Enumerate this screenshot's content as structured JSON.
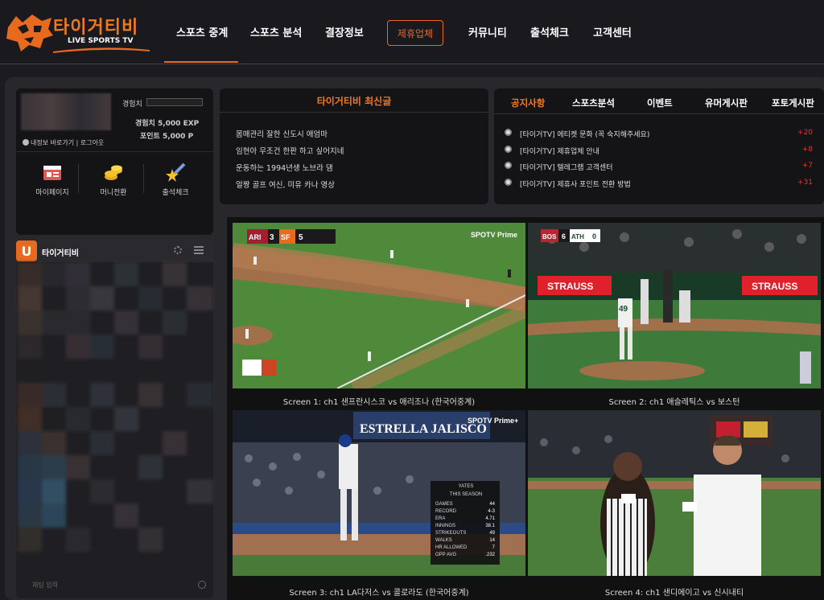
{
  "brand": {
    "name": "타이거티비",
    "tagline": "LIVE SPORTS TV"
  },
  "nav": {
    "items": [
      "스포츠 중계",
      "스포츠 분석",
      "결장정보",
      "제휴업체",
      "커뮤니티",
      "출석체크",
      "고객센터"
    ],
    "active_highlight": "제휴업체",
    "underline_item": "스포츠 중계"
  },
  "user": {
    "exp_label": "경험치",
    "exp_value": "경험치 5,000 EXP",
    "points_value": "포인트 5,000 P",
    "links": "내정보 바로가기 | 로그아웃",
    "quick": [
      "마이페이지",
      "머니전환",
      "출석체크"
    ]
  },
  "chat": {
    "title": "타이거티비",
    "input_placeholder": "채팅 입력"
  },
  "latest": {
    "title": "타이거티비 최신글",
    "posts": [
      "몸매관리 잘한 신도시 애엄마",
      "임현아 무조건 한판 하고 싶어지네",
      "운동하는 1994년생 노브라 댐",
      "얼짱 골프 여신, 미유 카나 영상"
    ]
  },
  "notice": {
    "tabs": [
      "공지사항",
      "스포츠분석",
      "이벤트",
      "유머게시판",
      "포토게시판"
    ],
    "active_tab": "공지사항",
    "items": [
      {
        "text": "[타이거TV] 에티켓 문화 (꼭 숙지해주세요)",
        "count": "+20"
      },
      {
        "text": "[타이거TV] 제휴업체 안내",
        "count": "+8"
      },
      {
        "text": "[타이거TV] 텔레그램 고객센터",
        "count": "+7"
      },
      {
        "text": "[타이거TV] 제휴사 포인트 전환 방법",
        "count": "+31"
      }
    ]
  },
  "screens": [
    {
      "caption": "Screen 1: ch1 샌프란시스코 vs 애리조나 (한국어중계)",
      "broadcaster": "SPOTV Prime",
      "score": {
        "away": "ARI",
        "away_score": "3",
        "home": "SF",
        "home_score": "5"
      }
    },
    {
      "caption": "Screen 2: ch1 애슬레틱스 vs 보스턴",
      "score": {
        "away": "BOS",
        "away_score": "6",
        "home": "ATH",
        "home_score": "0"
      },
      "ad": "STRAUSS",
      "jersey": "49"
    },
    {
      "caption": "Screen 3: ch1 LA다저스 vs 콜로라도 (한국어중계)",
      "broadcaster": "SPOTV Prime+",
      "sign": "ESTRELLA JALISCO",
      "stat_box": {
        "name": "YATES",
        "subtitle": "THIS SEASON",
        "rows": [
          [
            "GAMES",
            "44"
          ],
          [
            "RECORD",
            "4-3"
          ],
          [
            "ERA",
            "4.71"
          ],
          [
            "INNINGS",
            "38.1"
          ],
          [
            "STRIKEOUTS",
            "49"
          ],
          [
            "WALKS",
            "14"
          ],
          [
            "HR ALLOWED",
            "7"
          ],
          [
            "OPP AVG",
            ".232"
          ]
        ]
      }
    },
    {
      "caption": "Screen 4: ch1 샌디에이고 vs 신시내티"
    }
  ],
  "colors": {
    "accent": "#e86a1e",
    "bg": "#1c1c20",
    "panel": "#141417",
    "count": "#e33333"
  }
}
